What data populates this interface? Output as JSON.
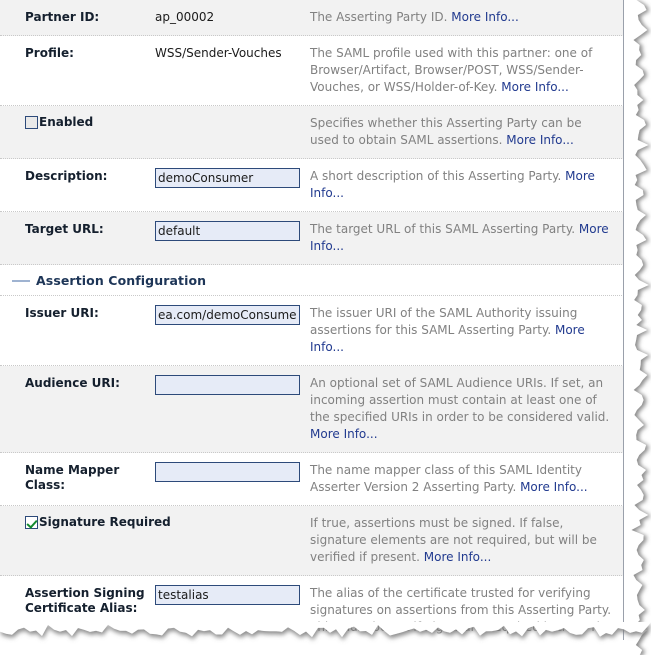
{
  "form": {
    "section_title": "Assertion Configuration",
    "more_info_label": "More Info...",
    "rows": [
      {
        "id": "partner-id",
        "type": "readonly",
        "label": "Partner ID:",
        "value": "ap_00002",
        "desc": "The Asserting Party ID. ",
        "link": "More Info...",
        "shaded": true
      },
      {
        "id": "profile",
        "type": "readonly",
        "label": "Profile:",
        "value": "WSS/Sender-Vouches",
        "desc": "The SAML profile used with this partner: one of Browser/Artifact, Browser/POST, WSS/Sender-Vouches, or WSS/Holder-of-Key. ",
        "link": "More Info...",
        "shaded": false
      },
      {
        "id": "enabled",
        "type": "checkbox",
        "label": "Enabled",
        "checked": false,
        "desc": "Specifies whether this Asserting Party can be used to obtain SAML assertions. ",
        "link": "More Info...",
        "shaded": true
      },
      {
        "id": "description",
        "type": "input",
        "label": "Description:",
        "value": "demoConsumer",
        "desc": "A short description of this Asserting Party. ",
        "link": "More Info...",
        "shaded": false
      },
      {
        "id": "target-url",
        "type": "input",
        "label": "Target URL:",
        "value": "default",
        "desc": "The target URL of this SAML Asserting Party. ",
        "link": "More Info...",
        "shaded": true
      },
      {
        "id": "issuer-uri",
        "type": "input",
        "label": "Issuer URI:",
        "value": "ea.com/demoConsumer",
        "desc": "The issuer URI of the SAML Authority issuing assertions for this SAML Asserting Party. ",
        "link": "More Info...",
        "shaded": false
      },
      {
        "id": "audience-uri",
        "type": "input",
        "label": "Audience URI:",
        "value": "",
        "desc": "An optional set of SAML Audience URIs. If set, an incoming assertion must contain at least one of the specified URIs in order to be considered valid. ",
        "link": "More Info...",
        "shaded": true
      },
      {
        "id": "name-mapper-class",
        "type": "input",
        "label": "Name Mapper Class:",
        "value": "",
        "desc": "The name mapper class of this SAML Identity Asserter Version 2 Asserting Party. ",
        "link": "More Info...",
        "shaded": false
      },
      {
        "id": "signature-required",
        "type": "checkbox",
        "label": "Signature Required",
        "checked": true,
        "desc": "If true, assertions must be signed. If false, signature elements are not required, but will be verified if present. ",
        "link": "More Info...",
        "shaded": true
      },
      {
        "id": "assertion-signing-certificate-alias",
        "type": "input",
        "label": "Assertion Signing Certificate Alias:",
        "value": "testalias",
        "desc": "The alias of the certificate trusted for verifying signatures on assertions from this Asserting Party. This must be set if Signature Required is true. The",
        "link": "",
        "shaded": false
      }
    ]
  },
  "colors": {
    "label_text": "#15202e",
    "desc_text": "#818181",
    "link": "#213a8f",
    "input_bg": "#e6ebf7",
    "input_border": "#2d4a7a",
    "row_shaded_bg": "#f2f2f2",
    "row_bg": "#ffffff",
    "section_rule": "#9fb3d1",
    "section_title": "#1d3557",
    "check_mark": "#138a2e",
    "panel_border": "#9aa0ab"
  }
}
